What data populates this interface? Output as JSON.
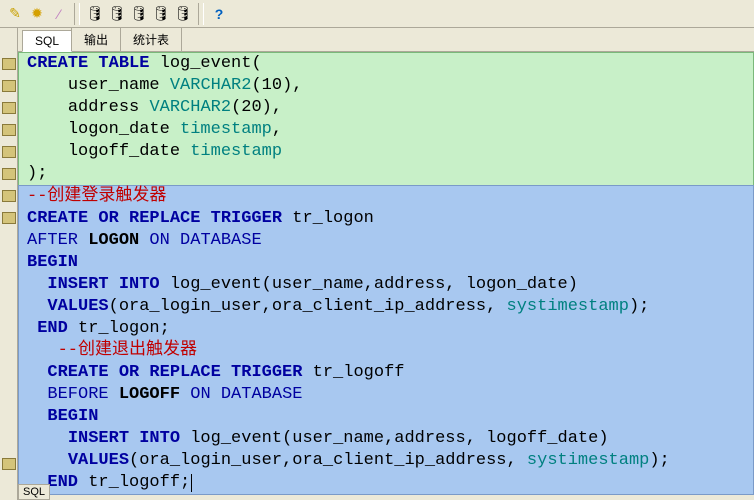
{
  "toolbar": {
    "icons": [
      "pencil",
      "bug",
      "brush",
      "sep",
      "db1",
      "db2",
      "db3",
      "db4",
      "db5",
      "sep2",
      "help"
    ]
  },
  "tabs": [
    {
      "label": "SQL",
      "active": true
    },
    {
      "label": "输出",
      "active": false
    },
    {
      "label": "统计表",
      "active": false
    }
  ],
  "sqlbadge": "SQL",
  "code": {
    "l1_kw": "CREATE TABLE ",
    "l1_id": "log_event",
    "l1_p": "(",
    "l2_sp": "    ",
    "l2_id": "user_name ",
    "l2_tp": "VARCHAR2",
    "l2_p": "(",
    "l2_n": "10",
    "l2_p2": "),",
    "l3_sp": "    ",
    "l3_id": "address ",
    "l3_tp": "VARCHAR2",
    "l3_p": "(",
    "l3_n": "20",
    "l3_p2": "),",
    "l4_sp": "    ",
    "l4_id": "logon_date ",
    "l4_tp": "timestamp",
    "l4_p": ",",
    "l5_sp": "    ",
    "l5_id": "logoff_date ",
    "l5_tp": "timestamp",
    "l6": ");",
    "c1": "--创建登录触发器",
    "l7_kw": "CREATE OR REPLACE TRIGGER ",
    "l7_id": "tr_logon",
    "l8_a": "AFTER ",
    "l8_b": "LOGON",
    "l8_c": " ON DATABASE",
    "l9": "BEGIN",
    "l10_sp": "  ",
    "l10_kw": "INSERT INTO ",
    "l10_id": "log_event",
    "l10_p": "(",
    "l10_args": "user_name,address, logon_date",
    "l10_p2": ")",
    "l11_sp": "  ",
    "l11_kw": "VALUES",
    "l11_p": "(",
    "l11_a": "ora_login_user",
    "l11_c1": ",",
    "l11_b": "ora_client_ip_address",
    "l11_c2": ", ",
    "l11_s": "systimestamp",
    "l11_p2": ");",
    "l12_sp": " ",
    "l12_kw": "END ",
    "l12_id": "tr_logon",
    "l12_p": ";",
    "c2_sp": "   ",
    "c2": "--创建退出触发器",
    "l13_sp": "  ",
    "l13_kw": "CREATE OR REPLACE TRIGGER ",
    "l13_id": "tr_logoff",
    "l14_sp": "  ",
    "l14_a": "BEFORE ",
    "l14_b": "LOGOFF",
    "l14_c": " ON DATABASE",
    "l15_sp": "  ",
    "l15": "BEGIN",
    "l16_sp": "    ",
    "l16_kw": "INSERT INTO ",
    "l16_id": "log_event",
    "l16_p": "(",
    "l16_args": "user_name,address, logoff_date",
    "l16_p2": ")",
    "l17_sp": "    ",
    "l17_kw": "VALUES",
    "l17_p": "(",
    "l17_a": "ora_login_user",
    "l17_c1": ",",
    "l17_b": "ora_client_ip_address",
    "l17_c2": ", ",
    "l17_s": "systimestamp",
    "l17_p2": ");",
    "l18_sp": "  ",
    "l18_kw": "END ",
    "l18_id": "tr_logoff",
    "l18_p": ";"
  }
}
